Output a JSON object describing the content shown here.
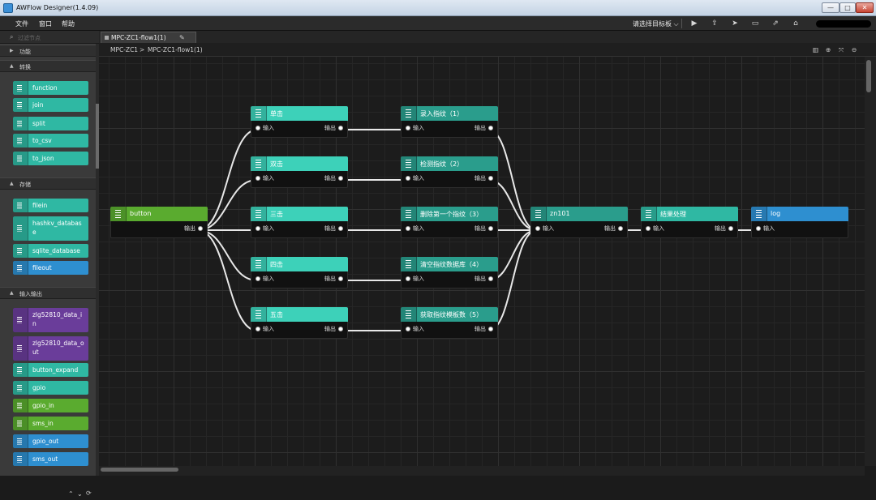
{
  "window": {
    "title": "AWFlow Designer(1.4.09)",
    "controls": {
      "minimize": "—",
      "maximize": "□",
      "close": "✕"
    }
  },
  "menu": {
    "items": [
      "文件",
      "窗口",
      "帮助"
    ],
    "target_select": "请选择目标板 ⌵"
  },
  "toolbar": {
    "icons": [
      "play-icon",
      "export-icon",
      "deploy-icon",
      "debug-icon",
      "share-icon",
      "device-icon"
    ]
  },
  "sidebar": {
    "search_placeholder": "过滤节点",
    "categories": [
      {
        "label": "功能",
        "expanded": false
      },
      {
        "label": "转换",
        "expanded": true
      },
      {
        "label": "存储",
        "expanded": true
      },
      {
        "label": "输入输出",
        "expanded": true
      }
    ],
    "palette": [
      {
        "label": "function",
        "color": "#2fb8a3"
      },
      {
        "label": "join",
        "color": "#2fb8a3"
      },
      {
        "label": "split",
        "color": "#2fb8a3"
      },
      {
        "label": "to_csv",
        "color": "#2fb8a3"
      },
      {
        "label": "to_json",
        "color": "#2fb8a3"
      },
      {
        "label": "filein",
        "color": "#2fb8a3"
      },
      {
        "label": "hashkv_database",
        "color": "#2fb8a3"
      },
      {
        "label": "sqlite_database",
        "color": "#2fb8a3"
      },
      {
        "label": "fileout",
        "color": "#2e8fd0"
      },
      {
        "label": "zlg52810_data_in",
        "color": "#6a3d9a"
      },
      {
        "label": "zlg52810_data_out",
        "color": "#6a3d9a"
      },
      {
        "label": "button_expand",
        "color": "#2fb8a3"
      },
      {
        "label": "gpio",
        "color": "#2fb8a3"
      },
      {
        "label": "gpio_in",
        "color": "#5aab2f"
      },
      {
        "label": "sms_in",
        "color": "#5aab2f"
      },
      {
        "label": "gpio_out",
        "color": "#2e8fd0"
      },
      {
        "label": "sms_out",
        "color": "#2e8fd0"
      }
    ],
    "footer_icons": [
      "chevron-up-icon",
      "chevron-down-icon",
      "refresh-icon"
    ]
  },
  "tab": {
    "label": "MPC-ZC1-flow1(1)"
  },
  "breadcrumb": {
    "root": "MPC-ZC1",
    "sep": ">",
    "current": "MPC-ZC1-flow1(1)"
  },
  "canvas_tools": [
    "map-icon",
    "zoom-in-icon",
    "fit-icon",
    "zoom-out-icon"
  ],
  "ports": {
    "in": "输入",
    "out": "输出"
  },
  "flow": {
    "nodes": [
      {
        "id": "button",
        "label": "button",
        "color": "#5aab2f",
        "in": false,
        "out": true
      },
      {
        "id": "n1",
        "label": "单击",
        "color": "#3dd1b9",
        "in": true,
        "out": true
      },
      {
        "id": "n2",
        "label": "双击",
        "color": "#3dd1b9",
        "in": true,
        "out": true
      },
      {
        "id": "n3",
        "label": "三击",
        "color": "#3dd1b9",
        "in": true,
        "out": true
      },
      {
        "id": "n4",
        "label": "四击",
        "color": "#3dd1b9",
        "in": true,
        "out": true
      },
      {
        "id": "n5",
        "label": "五击",
        "color": "#3dd1b9",
        "in": true,
        "out": true
      },
      {
        "id": "m1",
        "label": "录入指纹（1）",
        "color": "#2a9d8c",
        "in": true,
        "out": true
      },
      {
        "id": "m2",
        "label": "检测指纹（2）",
        "color": "#2a9d8c",
        "in": true,
        "out": true
      },
      {
        "id": "m3",
        "label": "删除第一个指纹（3）",
        "color": "#2a9d8c",
        "in": true,
        "out": true
      },
      {
        "id": "m4",
        "label": "清空指纹数据库（4）",
        "color": "#2a9d8c",
        "in": true,
        "out": true
      },
      {
        "id": "m5",
        "label": "获取指纹模板数（5）",
        "color": "#2a9d8c",
        "in": true,
        "out": true
      },
      {
        "id": "zn101",
        "label": "zn101",
        "color": "#2a9d8c",
        "in": true,
        "out": true
      },
      {
        "id": "res",
        "label": "结果处理",
        "color": "#2fb8a3",
        "in": true,
        "out": true
      },
      {
        "id": "log",
        "label": "log",
        "color": "#2e8fd0",
        "in": true,
        "out": false
      }
    ],
    "wires": [
      [
        "button",
        "n1"
      ],
      [
        "button",
        "n2"
      ],
      [
        "button",
        "n3"
      ],
      [
        "button",
        "n4"
      ],
      [
        "button",
        "n5"
      ],
      [
        "n1",
        "m1"
      ],
      [
        "n2",
        "m2"
      ],
      [
        "n3",
        "m3"
      ],
      [
        "n4",
        "m4"
      ],
      [
        "n5",
        "m5"
      ],
      [
        "m1",
        "zn101"
      ],
      [
        "m2",
        "zn101"
      ],
      [
        "m3",
        "zn101"
      ],
      [
        "m4",
        "zn101"
      ],
      [
        "m5",
        "zn101"
      ],
      [
        "zn101",
        "res"
      ],
      [
        "res",
        "log"
      ]
    ]
  }
}
